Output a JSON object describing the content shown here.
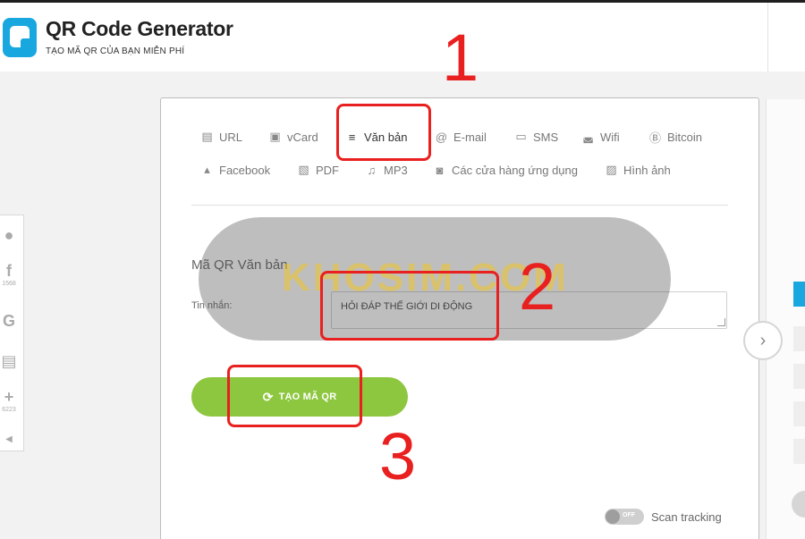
{
  "header": {
    "title": "QR Code Generator",
    "subtitle": "TẠO MÃ QR CỦA BẠN MIỄN PHÍ"
  },
  "social": {
    "facebook_count": "1568",
    "share_count": "6223"
  },
  "tabs": [
    {
      "label": "URL",
      "icon": "document-icon"
    },
    {
      "label": "vCard",
      "icon": "contact-card-icon"
    },
    {
      "label": "Văn bản",
      "icon": "text-lines-icon",
      "active": true
    },
    {
      "label": "E-mail",
      "icon": "at-icon"
    },
    {
      "label": "SMS",
      "icon": "chat-icon"
    },
    {
      "label": "Wifi",
      "icon": "wifi-icon"
    },
    {
      "label": "Bitcoin",
      "icon": "bitcoin-icon"
    },
    {
      "label": "Facebook",
      "icon": "thumbs-up-icon"
    },
    {
      "label": "PDF",
      "icon": "pdf-icon"
    },
    {
      "label": "MP3",
      "icon": "music-note-icon"
    },
    {
      "label": "Các cửa hàng ứng dụng",
      "icon": "app-store-icon"
    },
    {
      "label": "Hình ảnh",
      "icon": "image-icon"
    }
  ],
  "form": {
    "section_title": "Mã QR Văn bản",
    "message_label": "Tin nhắn:",
    "message_value": "HỎI ĐÁP THẾ GIỚI DI ĐỘNG"
  },
  "generate_button": {
    "label": "TẠO MÃ QR"
  },
  "scan_tracking": {
    "toggle_text": "OFF",
    "label": "Scan tracking"
  },
  "watermark": {
    "text": "KHOSIM.COM"
  },
  "annotations": {
    "one": "1",
    "two": "2",
    "three": "3"
  },
  "colors": {
    "brand_blue": "#19a7e0",
    "button_green": "#8dc63f",
    "annotation_red": "#e8201f"
  }
}
